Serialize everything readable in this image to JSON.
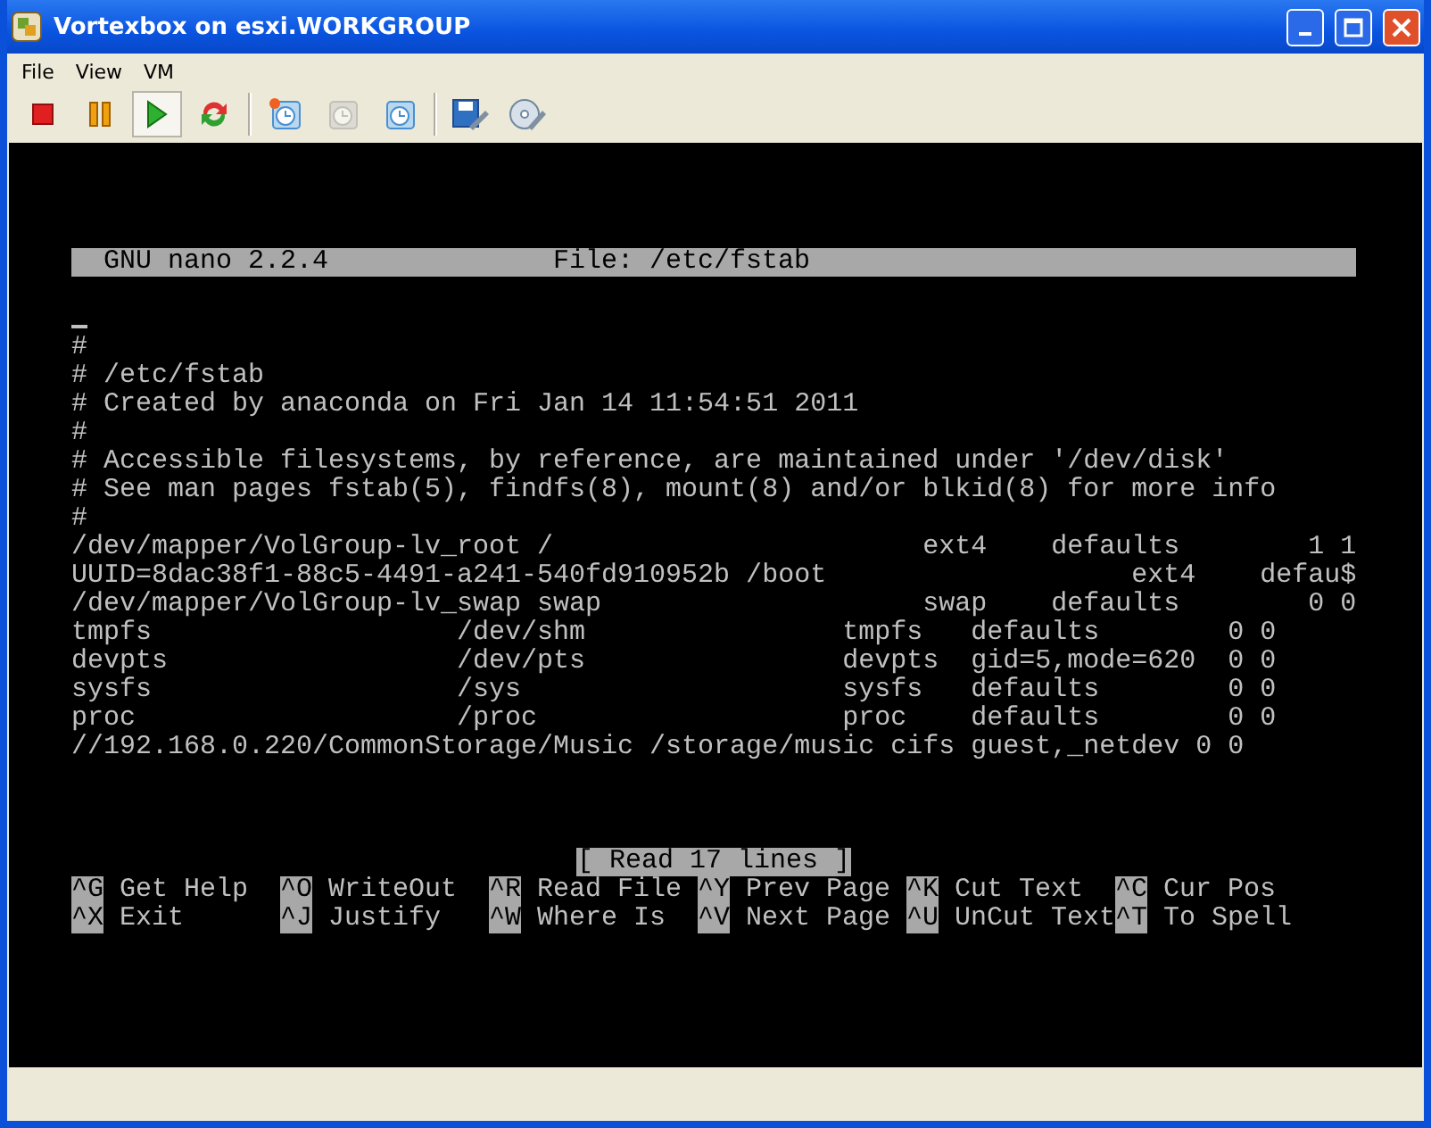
{
  "window": {
    "title": "Vortexbox on esxi.WORKGROUP"
  },
  "menu": [
    "File",
    "View",
    "VM"
  ],
  "toolbar": [
    [
      {
        "kind": "stop",
        "pressed": false,
        "disabled": false
      },
      {
        "kind": "pause",
        "pressed": false,
        "disabled": false
      },
      {
        "kind": "play",
        "pressed": true,
        "disabled": false
      },
      {
        "kind": "reset",
        "pressed": false,
        "disabled": false
      }
    ],
    [
      {
        "kind": "snapshot",
        "pressed": false,
        "disabled": false
      },
      {
        "kind": "revert",
        "pressed": false,
        "disabled": true
      },
      {
        "kind": "manage",
        "pressed": false,
        "disabled": false
      }
    ],
    [
      {
        "kind": "settings",
        "pressed": false,
        "disabled": false
      },
      {
        "kind": "media",
        "pressed": false,
        "disabled": false
      }
    ]
  ],
  "console": {
    "title_bar": {
      "program": "GNU nano 2.2.4",
      "file": "File: /etc/fstab"
    },
    "lines": [
      "#",
      "# /etc/fstab",
      "# Created by anaconda on Fri Jan 14 11:54:51 2011",
      "#",
      "# Accessible filesystems, by reference, are maintained under '/dev/disk'",
      "# See man pages fstab(5), findfs(8), mount(8) and/or blkid(8) for more info",
      "#",
      "/dev/mapper/VolGroup-lv_root /                       ext4    defaults        1 1",
      "UUID=8dac38f1-88c5-4491-a241-540fd910952b /boot                   ext4    defau$",
      "/dev/mapper/VolGroup-lv_swap swap                    swap    defaults        0 0",
      "tmpfs                   /dev/shm                tmpfs   defaults        0 0",
      "devpts                  /dev/pts                devpts  gid=5,mode=620  0 0",
      "sysfs                   /sys                    sysfs   defaults        0 0",
      "proc                    /proc                   proc    defaults        0 0",
      "//192.168.0.220/CommonStorage/Music /storage/music cifs guest,_netdev 0 0"
    ],
    "status": "[ Read 17 lines ]",
    "shortcuts": [
      {
        "key": "^G",
        "label": "Get Help"
      },
      {
        "key": "^O",
        "label": "WriteOut"
      },
      {
        "key": "^R",
        "label": "Read File"
      },
      {
        "key": "^Y",
        "label": "Prev Page"
      },
      {
        "key": "^K",
        "label": "Cut Text"
      },
      {
        "key": "^C",
        "label": "Cur Pos"
      },
      {
        "key": "^X",
        "label": "Exit"
      },
      {
        "key": "^J",
        "label": "Justify"
      },
      {
        "key": "^W",
        "label": "Where Is"
      },
      {
        "key": "^V",
        "label": "Next Page"
      },
      {
        "key": "^U",
        "label": "UnCut Text"
      },
      {
        "key": "^T",
        "label": "To Spell"
      }
    ]
  }
}
